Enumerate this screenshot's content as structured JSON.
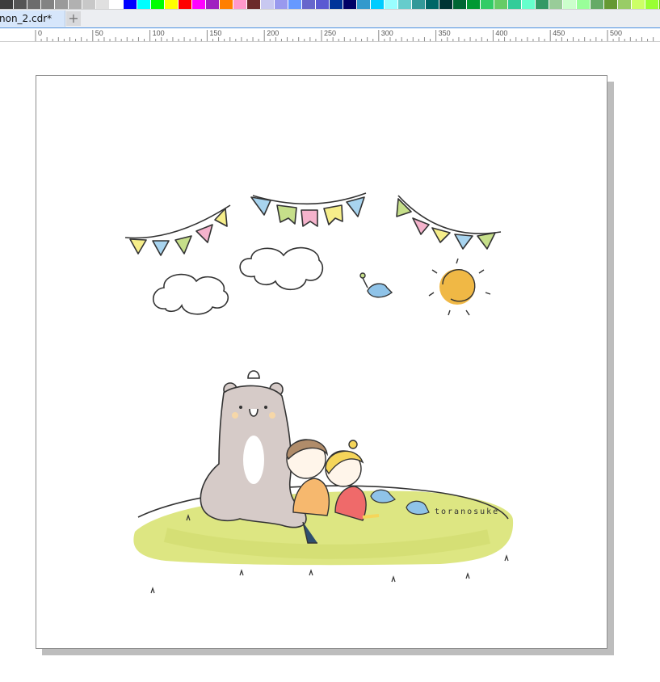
{
  "palette": {
    "colors": [
      "#3d3d3d",
      "#555555",
      "#6c6c6c",
      "#838383",
      "#9a9a9a",
      "#b1b1b1",
      "#c8c8c8",
      "#e0e0e0",
      "#ffffff",
      "#0000ff",
      "#00ffff",
      "#00ff00",
      "#ffff00",
      "#ff0000",
      "#ff00ff",
      "#a020c0",
      "#ff7f00",
      "#ff99cc",
      "#6b2b2b",
      "#c8c8f0",
      "#9999ee",
      "#6699ff",
      "#6666cc",
      "#5a5ad2",
      "#003399",
      "#000066",
      "#3399cc",
      "#00ccff",
      "#99ffff",
      "#66cccc",
      "#339999",
      "#006666",
      "#003333",
      "#006633",
      "#009933",
      "#33cc66",
      "#66cc66",
      "#33cc99",
      "#66ffcc",
      "#339966",
      "#99cc99",
      "#ccffcc",
      "#99ff99",
      "#66aa66",
      "#669933",
      "#99cc66",
      "#ccff66",
      "#99ff33",
      "#66cc00",
      "#ccff99"
    ]
  },
  "tabs": {
    "document_tab_label": "non_2.cdr*",
    "add_tab_label": "+"
  },
  "ruler": {
    "labels": [
      "0",
      "50",
      "100",
      "150",
      "200",
      "250",
      "300",
      "350",
      "400",
      "450",
      "500"
    ]
  },
  "artwork": {
    "signature": "toranosuke"
  }
}
